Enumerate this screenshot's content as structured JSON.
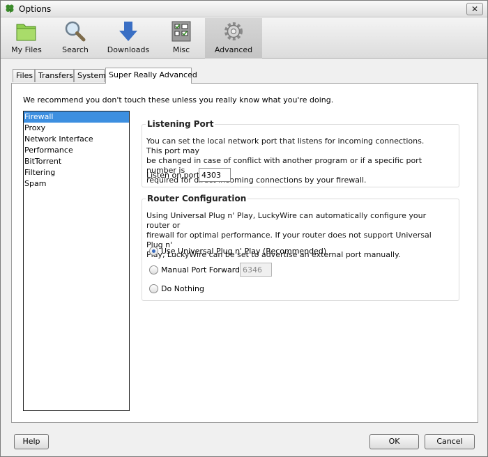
{
  "window": {
    "title": "Options"
  },
  "toolbar": {
    "items": [
      {
        "label": "My Files",
        "icon": "folder-icon"
      },
      {
        "label": "Search",
        "icon": "magnifier-icon"
      },
      {
        "label": "Downloads",
        "icon": "download-arrow-icon"
      },
      {
        "label": "Misc",
        "icon": "checklist-icon"
      },
      {
        "label": "Advanced",
        "icon": "gear-icon",
        "active": true
      }
    ]
  },
  "tabs": [
    "Files",
    "Transfers",
    "System",
    "Super Really Advanced"
  ],
  "active_tab": "Super Really Advanced",
  "panel": {
    "intro": "We recommend you don't touch these unless you really know what you're doing.",
    "categories": [
      "Firewall",
      "Proxy",
      "Network Interface",
      "Performance",
      "BitTorrent",
      "Filtering",
      "Spam"
    ],
    "selected_category": "Firewall",
    "listening_port": {
      "title": "Listening Port",
      "description": [
        "You can set the local network port that listens for incoming connections. This port may",
        "be changed in case of conflict with another program or if a specific port number is",
        "required for direct incoming connections by your firewall."
      ],
      "field_label": "Listen on port:",
      "value": "4303"
    },
    "router": {
      "title": "Router Configuration",
      "description": [
        "Using Universal Plug n' Play, LuckyWire can automatically configure your router or",
        "firewall for optimal performance. If your router does not support Universal Plug n'",
        "Play, LuckyWire can be set to advertise an external port manually."
      ],
      "options": [
        {
          "label": "Use Universal Plug n' Play (Recommended)",
          "checked": true
        },
        {
          "label": "Manual Port Forward:",
          "checked": false
        },
        {
          "label": "Do Nothing",
          "checked": false
        }
      ],
      "manual_port": "6346"
    }
  },
  "buttons": {
    "help": "Help",
    "ok": "OK",
    "cancel": "Cancel"
  },
  "colors": {
    "selection": "#3d8fe0",
    "download_arrow": "#3a6fc4",
    "folder": "#7bbf3a"
  }
}
